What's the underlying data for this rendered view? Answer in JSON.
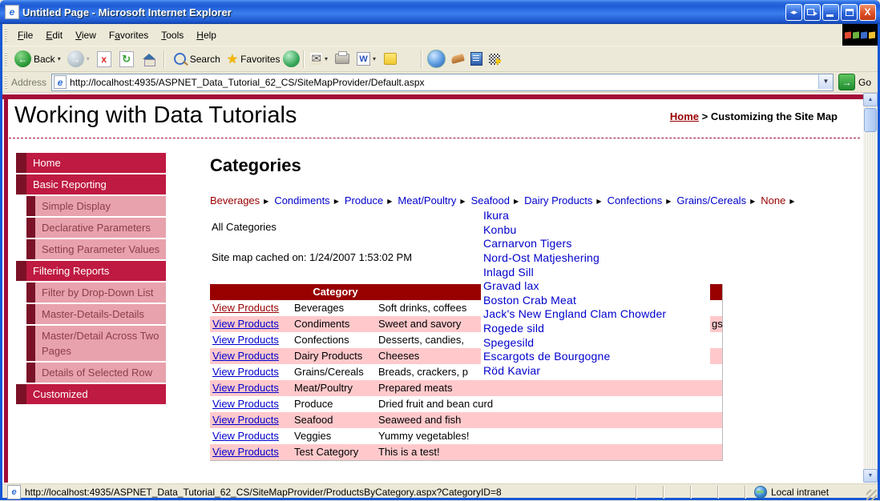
{
  "chrome": {
    "title": "Untitled Page - Microsoft Internet Explorer",
    "menus": [
      {
        "label": "File",
        "m": 0
      },
      {
        "label": "Edit",
        "m": 0
      },
      {
        "label": "View",
        "m": 0
      },
      {
        "label": "Favorites",
        "m": 1
      },
      {
        "label": "Tools",
        "m": 0
      },
      {
        "label": "Help",
        "m": 0
      }
    ],
    "toolbar": {
      "back": "Back",
      "search": "Search",
      "favorites": "Favorites"
    },
    "address": {
      "label": "Address",
      "url": "http://localhost:4935/ASPNET_Data_Tutorial_62_CS/SiteMapProvider/Default.aspx",
      "go": "Go"
    },
    "status": {
      "url": "http://localhost:4935/ASPNET_Data_Tutorial_62_CS/SiteMapProvider/ProductsByCategory.aspx?CategoryID=8",
      "zone": "Local intranet"
    }
  },
  "page": {
    "site_title": "Working with Data Tutorials",
    "breadcrumb": {
      "home": "Home",
      "sep": " > ",
      "current": "Customizing the Site Map"
    },
    "sidebar": [
      {
        "label": "Home",
        "level": 0
      },
      {
        "label": "Basic Reporting",
        "level": 0
      },
      {
        "label": "Simple Display",
        "level": 1
      },
      {
        "label": "Declarative Parameters",
        "level": 1
      },
      {
        "label": "Setting Parameter Values",
        "level": 1
      },
      {
        "label": "Filtering Reports",
        "level": 0
      },
      {
        "label": "Filter by Drop-Down List",
        "level": 1
      },
      {
        "label": "Master-Details-Details",
        "level": 1
      },
      {
        "label": "Master/Detail Across Two Pages",
        "level": 1
      },
      {
        "label": "Details of Selected Row",
        "level": 1
      },
      {
        "label": "Customized",
        "level": 0
      }
    ],
    "main": {
      "heading": "Categories",
      "category_menu": [
        {
          "label": "Beverages",
          "highlight": true
        },
        {
          "label": "Condiments"
        },
        {
          "label": "Produce"
        },
        {
          "label": "Meat/Poultry"
        },
        {
          "label": "Seafood"
        },
        {
          "label": "Dairy Products"
        },
        {
          "label": "Confections"
        },
        {
          "label": "Grains/Cereals"
        },
        {
          "label": "None",
          "highlight": true
        }
      ],
      "all_categories": "All Categories",
      "cache_note": "Site map cached on: 1/24/2007 1:53:02 PM",
      "table": {
        "headers": [
          "",
          "Category",
          ""
        ],
        "view_link": "View Products",
        "rows": [
          {
            "category": "Beverages",
            "description": "Soft drinks, coffees",
            "visited": true
          },
          {
            "category": "Condiments",
            "description": "Sweet and savory",
            "tail": "gs"
          },
          {
            "category": "Confections",
            "description": "Desserts, candies,"
          },
          {
            "category": "Dairy Products",
            "description": "Cheeses"
          },
          {
            "category": "Grains/Cereals",
            "description": "Breads, crackers, p"
          },
          {
            "category": "Meat/Poultry",
            "description": "Prepared meats"
          },
          {
            "category": "Produce",
            "description": "Dried fruit and bean curd"
          },
          {
            "category": "Seafood",
            "description": "Seaweed and fish"
          },
          {
            "category": "Veggies",
            "description": "Yummy vegetables!"
          },
          {
            "category": "Test Category",
            "description": "This is a test!"
          }
        ]
      },
      "submenu": [
        "Ikura",
        "Konbu",
        "Carnarvon Tigers",
        "Nord-Ost Matjeshering",
        "Inlagd Sill",
        "Gravad lax",
        "Boston Crab Meat",
        "Jack's New England Clam Chowder",
        "Rogede sild",
        "Spegesild",
        "Escargots de Bourgogne",
        "Röd Kaviar"
      ]
    }
  },
  "colors": {
    "maroon": "#990000",
    "crimson": "#bf1a41",
    "dark_block": "#7a1127",
    "pink_item": "#e8a2ad",
    "pink_row": "#ffc9cc",
    "link_blue": "#0000cc",
    "top_bar": "#a30e36"
  }
}
